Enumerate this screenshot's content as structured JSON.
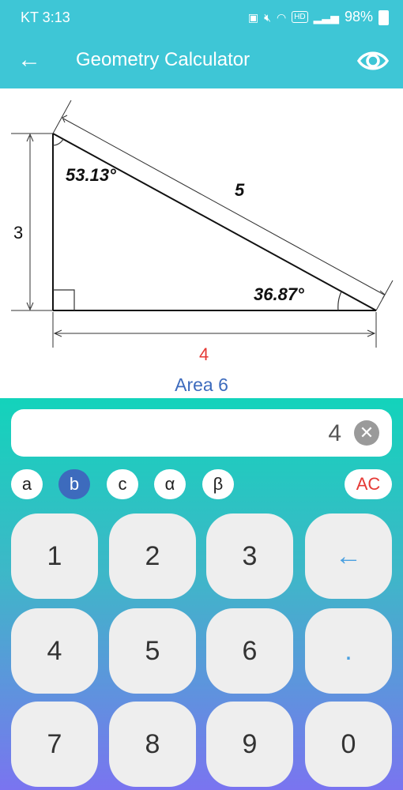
{
  "status": {
    "time": "KT 3:13",
    "battery": "98%",
    "hd": "HD"
  },
  "appbar": {
    "title": "Geometry Calculator"
  },
  "figure": {
    "side_a": "3",
    "side_b": "4",
    "side_c": "5",
    "angle_alpha": "53.13°",
    "angle_beta": "36.87°",
    "colors": {
      "side_b": "#e53935"
    }
  },
  "area_text": "Area 6",
  "display": {
    "value": "4"
  },
  "chips": [
    {
      "label": "a",
      "selected": false
    },
    {
      "label": "b",
      "selected": true
    },
    {
      "label": "c",
      "selected": false
    },
    {
      "label": "α",
      "selected": false
    },
    {
      "label": "β",
      "selected": false
    }
  ],
  "ac_label": "AC",
  "keys": [
    "1",
    "2",
    "3",
    "←",
    "4",
    "5",
    "6",
    ".",
    "7",
    "8",
    "9",
    "0"
  ]
}
